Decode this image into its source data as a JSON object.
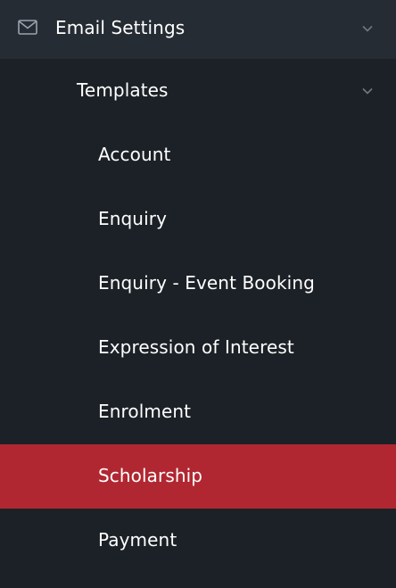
{
  "menu": {
    "parent": {
      "label": "Email Settings",
      "icon": "mail-icon"
    },
    "sub": {
      "label": "Templates"
    },
    "items": [
      {
        "label": "Account"
      },
      {
        "label": "Enquiry"
      },
      {
        "label": "Enquiry - Event Booking"
      },
      {
        "label": "Expression of Interest"
      },
      {
        "label": "Enrolment"
      },
      {
        "label": "Scholarship",
        "active": true
      },
      {
        "label": "Payment"
      }
    ]
  },
  "colors": {
    "background": "#1c2127",
    "parent_background": "#262c34",
    "active_background": "#b12731",
    "text": "#ffffff",
    "icon": "#9aa3ad"
  }
}
